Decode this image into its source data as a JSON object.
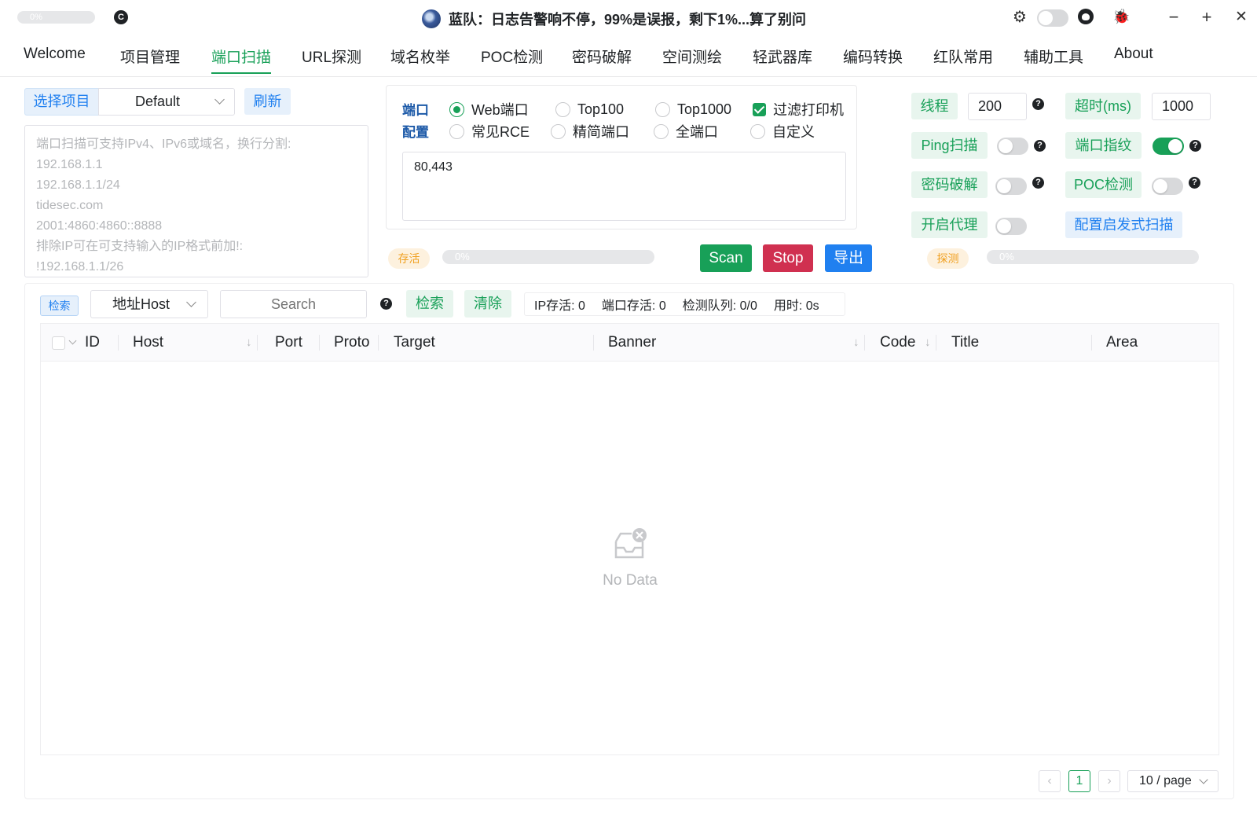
{
  "titlebar": {
    "progress_text": "0%",
    "title": "蓝队：日志告警响不停，99%是误报，剩下1%...算了别问",
    "window_buttons": {
      "minimize": "−",
      "maximize": "+",
      "close": "✕"
    }
  },
  "tabs": [
    {
      "label": "Welcome"
    },
    {
      "label": "项目管理"
    },
    {
      "label": "端口扫描",
      "active": true
    },
    {
      "label": "URL探测"
    },
    {
      "label": "域名枚举"
    },
    {
      "label": "POC检测"
    },
    {
      "label": "密码破解"
    },
    {
      "label": "空间测绘"
    },
    {
      "label": "轻武器库"
    },
    {
      "label": "编码转换"
    },
    {
      "label": "红队常用"
    },
    {
      "label": "辅助工具"
    },
    {
      "label": "About"
    }
  ],
  "project": {
    "select_label": "选择项目",
    "selected": "Default",
    "refresh_label": "刷新"
  },
  "targets": {
    "placeholder": "端口扫描可支持IPv4、IPv6或域名，换行分割:\n192.168.1.1\n192.168.1.1/24\ntidesec.com\n2001:4860:4860::8888\n排除IP可在可支持输入的IP格式前加!:\n!192.168.1.1/26"
  },
  "port_config": {
    "label_line1": "端口",
    "label_line2": "配置",
    "options": {
      "web": "Web端口",
      "top100": "Top100",
      "top1000": "Top1000",
      "filter_printer": "过滤打印机",
      "rce": "常见RCE",
      "simple": "精简端口",
      "all": "全端口",
      "custom": "自定义"
    },
    "selected": "web",
    "filter_printer_checked": true,
    "ports_value": "80,443"
  },
  "alive": {
    "tag": "存活",
    "progress_text": "0%",
    "progress": 0
  },
  "actions": {
    "scan": "Scan",
    "stop": "Stop",
    "export": "导出"
  },
  "probe": {
    "tag": "探测",
    "progress_text": "0%",
    "progress": 0
  },
  "settings": {
    "threads_label": "线程",
    "threads_value": "200",
    "timeout_label": "超时(ms)",
    "timeout_value": "1000",
    "ping_label": "Ping扫描",
    "ping_on": false,
    "fingerprint_label": "端口指纹",
    "fingerprint_on": true,
    "crack_label": "密码破解",
    "crack_on": false,
    "poc_label": "POC检测",
    "poc_on": false,
    "proxy_label": "开启代理",
    "proxy_on": false,
    "heuristic_label": "配置启发式扫描",
    "help_glyph": "?"
  },
  "filter": {
    "tag": "检索",
    "field": "地址Host",
    "search_placeholder": "Search",
    "search_button": "检索",
    "clear_button": "清除",
    "stats": {
      "ip_alive": "IP存活: 0",
      "port_alive": "端口存活: 0",
      "queue": "检测队列: 0/0",
      "elapsed": "用时: 0s"
    }
  },
  "table": {
    "columns": [
      "ID",
      "Host",
      "Port",
      "Proto",
      "Target",
      "Banner",
      "Code",
      "Title",
      "Area"
    ],
    "rows": [],
    "empty_text": "No Data"
  },
  "pagination": {
    "prev": "‹",
    "next": "›",
    "current": "1",
    "page_size": "10 / page"
  },
  "colors": {
    "primary_green": "#18a058",
    "info_blue": "#2080f0",
    "danger_red": "#d03050",
    "warning_orange": "#f0a020"
  }
}
